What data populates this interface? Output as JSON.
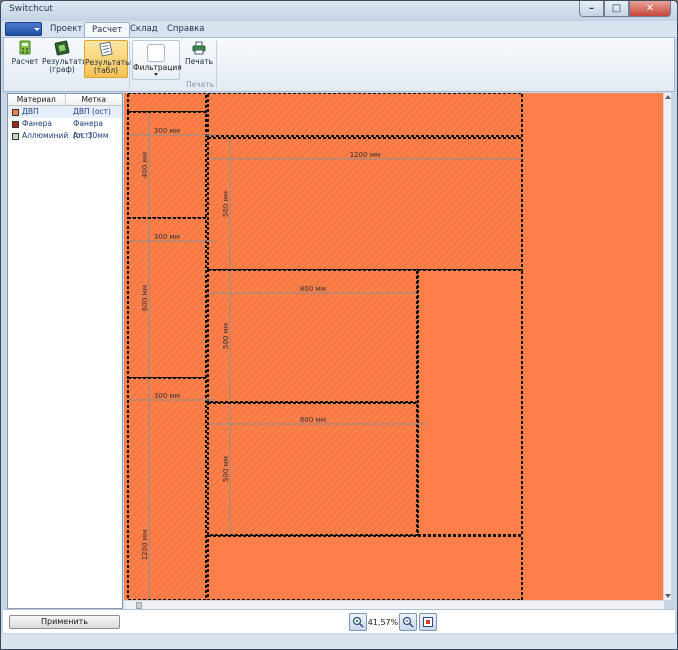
{
  "window": {
    "title": "Switchcut"
  },
  "menu": {
    "tabs": [
      {
        "label": "Проект"
      },
      {
        "label": "Расчет"
      },
      {
        "label": "Склад"
      },
      {
        "label": "Справка"
      }
    ]
  },
  "ribbon": {
    "buttons": [
      {
        "label": "Расчет"
      },
      {
        "label": "Результаты (граф)"
      },
      {
        "label": "Результаты (табл)"
      }
    ],
    "filter_label": "Фильтрация",
    "print_label": "Печать",
    "group_print": "Печать"
  },
  "materials": {
    "col_material": "Материал",
    "col_label": "Метка",
    "rows": [
      {
        "name": "ДВП",
        "mark": "ДВП (ост)",
        "color": "#ff7f4a"
      },
      {
        "name": "Фанера",
        "mark": "Фанера (ост)",
        "color": "#a0281e"
      },
      {
        "name": "Аллюминий",
        "mark": "Ал. 30мм",
        "color": "#c8d3c0"
      }
    ]
  },
  "layout": {
    "sheet_color": "#ff7f4a",
    "dims": {
      "d300a": "300 мм",
      "d1200a": "1200 мм",
      "d400": "400 мм",
      "d500a": "500 мм",
      "d300b": "300 мм",
      "d600": "600 мм",
      "d800a": "800 мм",
      "d500b": "500 мм",
      "d300c": "300 мм",
      "d800b": "800 мм",
      "d500c": "500 мм",
      "d1200b": "1200 мм"
    }
  },
  "footer": {
    "apply_label": "Применить",
    "zoom": "41,57%"
  }
}
